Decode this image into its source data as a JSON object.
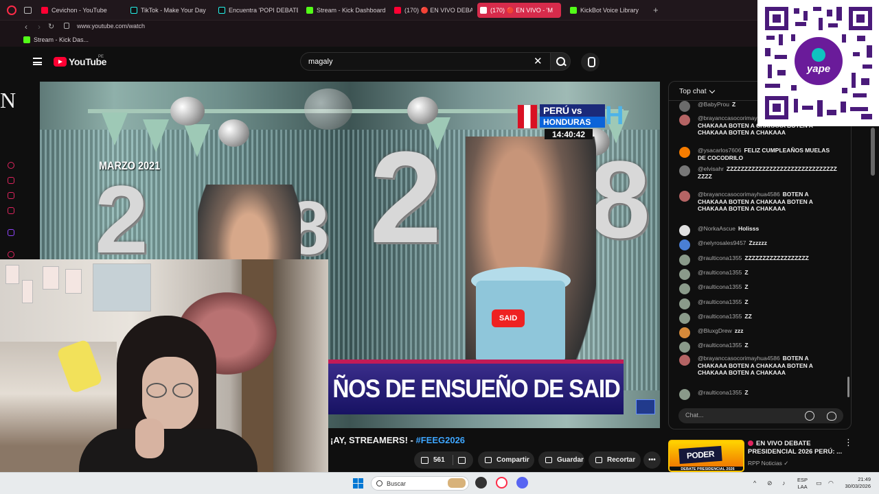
{
  "browser": {
    "tabs": [
      {
        "label": "Cevichon - YouTube",
        "icon": "youtube"
      },
      {
        "label": "TikTok - Make Your Day",
        "icon": "tiktok"
      },
      {
        "label": "Encuentra 'POPI DEBATE'",
        "icon": "tiktok"
      },
      {
        "label": "Stream - Kick Dashboard",
        "icon": "kick"
      },
      {
        "label": "(170) 🔴 EN VIVO DEBAT",
        "icon": "youtube"
      },
      {
        "label": "(170) 🔴 EN VIVO - 'M",
        "icon": "youtube",
        "active": true
      },
      {
        "label": "KickBot Voice Library",
        "icon": "kick"
      }
    ],
    "url": "www.youtube.com/watch",
    "bookmark": "Stream - Kick Das..."
  },
  "youtube": {
    "logo_text": "YouTube",
    "region": "PE",
    "search_value": "magaly"
  },
  "video": {
    "overlay_date": "MARZO 2021",
    "score_line1": "PERÚ vs",
    "score_line2": "HONDURAS",
    "score_time": "14:40:42",
    "cake_tag": "SAID",
    "lower_third": "ÑOS DE ENSUEÑO DE SAID",
    "digit_2": "2",
    "digit_8": "8"
  },
  "below": {
    "title_text": "¡AY, STREAMERS! - ",
    "title_tag": "#FEEG2026",
    "likes": "561",
    "share_label": "Compartir",
    "save_label": "Guardar",
    "clip_label": "Recortar",
    "more_label": "•••"
  },
  "chat": {
    "header": "Top chat",
    "input_placeholder": "Chat...",
    "messages": [
      {
        "author": "@BabyProu",
        "text": "Z",
        "color": "#6b6b6b"
      },
      {
        "author": "@brayanccasocorimayhua4586",
        "text": "BOTEN A CHAKAAA BOTEN A CHAKAAA BOTEN A CHAKAAA BOTEN A CHAKAAA",
        "color": "#b46464"
      },
      {
        "author": "@ysacarlos7606",
        "text": "FELIZ CUMPLEAÑOS MUELAS DE COCODRILO",
        "color": "#f57c00"
      },
      {
        "author": "@elvisahr",
        "text": "ZZZZZZZZZZZZZZZZZZZZZZZZZZZZZZZZZZZ",
        "color": "#777"
      },
      {
        "author": "@brayanccasocorimayhua4586",
        "text": "BOTEN A CHAKAAA BOTEN A CHAKAAA BOTEN A CHAKAAA BOTEN A CHAKAAA",
        "color": "#b46464"
      },
      {
        "author": "@NorkaAscue",
        "text": "Holisss",
        "color": "#e0e0e0"
      },
      {
        "author": "@nelyrosales9457",
        "text": "Zzzzzz",
        "color": "#4a7fd4"
      },
      {
        "author": "@raulticona1355",
        "text": "ZZZZZZZZZZZZZZZZZZ",
        "color": "#8a9a8a"
      },
      {
        "author": "@raulticona1355",
        "text": "Z",
        "color": "#8a9a8a"
      },
      {
        "author": "@raulticona1355",
        "text": "Z",
        "color": "#8a9a8a"
      },
      {
        "author": "@raulticona1355",
        "text": "Z",
        "color": "#8a9a8a"
      },
      {
        "author": "@raulticona1355",
        "text": "ZZ",
        "color": "#8a9a8a"
      },
      {
        "author": "@BluxgDrew",
        "text": "zzz",
        "color": "#d68a3a"
      },
      {
        "author": "@raulticona1355",
        "text": "Z",
        "color": "#8a9a8a"
      },
      {
        "author": "@brayanccasocorimayhua4586",
        "text": "BOTEN A CHAKAAA BOTEN A CHAKAAA BOTEN A CHAKAAA BOTEN A CHAKAAA",
        "color": "#b46464"
      },
      {
        "author": "@raulticona1355",
        "text": "Z",
        "color": "#8a9a8a"
      }
    ]
  },
  "recommended": {
    "thumb_text": "PODER",
    "thumb_sub": "DEBATE PRESIDENCIAL 2026",
    "title": "EN VIVO DEBATE PRESIDENCIAL 2026 PERÚ: ...",
    "channel": "RPP Noticias ✓"
  },
  "qr": {
    "brand": "yape"
  },
  "taskbar": {
    "search_placeholder": "Buscar",
    "lang_line1": "ESP",
    "lang_line2": "LAA",
    "time": "21:49",
    "date": "30/03/2026"
  },
  "overlay_letter": "N"
}
